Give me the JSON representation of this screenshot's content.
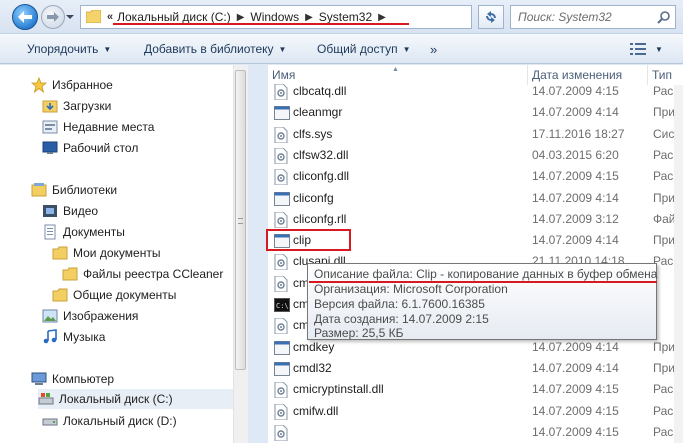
{
  "address_bar": {
    "chevron": "«",
    "crumbs": [
      "Локальный диск (C:)",
      "Windows",
      "System32"
    ],
    "search_placeholder": "Поиск: System32"
  },
  "toolbar": {
    "organize": "Упорядочить",
    "add_library": "Добавить в библиотеку",
    "share": "Общий доступ",
    "more": "»"
  },
  "nav": {
    "favorites": "Избранное",
    "downloads": "Загрузки",
    "recent": "Недавние места",
    "desktop": "Рабочий стол",
    "libraries": "Библиотеки",
    "video": "Видео",
    "documents": "Документы",
    "my_documents": "Мои документы",
    "ccleaner": "Файлы реестра CCleaner",
    "public_documents": "Общие документы",
    "images": "Изображения",
    "music": "Музыка",
    "computer": "Компьютер",
    "disk_c": "Локальный диск (C:)",
    "disk_d": "Локальный диск (D:)"
  },
  "columns": {
    "name": "Имя",
    "date": "Дата изменения",
    "type": "Тип"
  },
  "files": [
    {
      "name": "clbcatq.dll",
      "date": "14.07.2009 4:15",
      "type": "Рас",
      "icon": "dll-icon"
    },
    {
      "name": "cleanmgr",
      "date": "14.07.2009 4:14",
      "type": "При",
      "icon": "app-icon"
    },
    {
      "name": "clfs.sys",
      "date": "17.11.2016 18:27",
      "type": "Сист",
      "icon": "sys-icon"
    },
    {
      "name": "clfsw32.dll",
      "date": "04.03.2015 6:20",
      "type": "Рас",
      "icon": "dll-icon"
    },
    {
      "name": "cliconfg.dll",
      "date": "14.07.2009 4:15",
      "type": "Рас",
      "icon": "dll-icon"
    },
    {
      "name": "cliconfg",
      "date": "14.07.2009 4:14",
      "type": "При",
      "icon": "app-icon"
    },
    {
      "name": "cliconfg.rll",
      "date": "14.07.2009 3:12",
      "type": "Фай",
      "icon": "dll-icon"
    },
    {
      "name": "clip",
      "date": "14.07.2009 4:14",
      "type": "При",
      "icon": "app-icon"
    },
    {
      "name": "clusapi.dll",
      "date": "21.11.2010 14:18",
      "type": "Рас",
      "icon": "dll-icon"
    },
    {
      "name": "cm",
      "date": "",
      "type": "",
      "icon": "dll-icon"
    },
    {
      "name": "cm",
      "date": "",
      "type": "",
      "icon": "cmd-icon"
    },
    {
      "name": "cm",
      "date": "",
      "type": "",
      "icon": "dll-icon"
    },
    {
      "name": "cmdkey",
      "date": "14.07.2009 4:14",
      "type": "При",
      "icon": "app-icon"
    },
    {
      "name": "cmdl32",
      "date": "14.07.2009 4:14",
      "type": "При",
      "icon": "app-icon"
    },
    {
      "name": "cmicryptinstall.dll",
      "date": "14.07.2009 4:15",
      "type": "Рас",
      "icon": "dll-icon"
    },
    {
      "name": "cmifw.dll",
      "date": "14.07.2009 4:15",
      "type": "Рас",
      "icon": "dll-icon"
    },
    {
      "name": "",
      "date": "14.07.2009 4:15",
      "type": "Рас",
      "icon": "dll-icon"
    }
  ],
  "tooltip": {
    "description": "Описание файла: Clip - копирование данных в буфер обмена",
    "organization": "Организация: Microsoft Corporation",
    "version": "Версия файла: 6.1.7600.16385",
    "created": "Дата создания: 14.07.2009 2:15",
    "size": "Размер: 25,5 КБ"
  },
  "colors": {
    "highlight_red": "#d71920",
    "window_blue": "#dfe9f5"
  }
}
